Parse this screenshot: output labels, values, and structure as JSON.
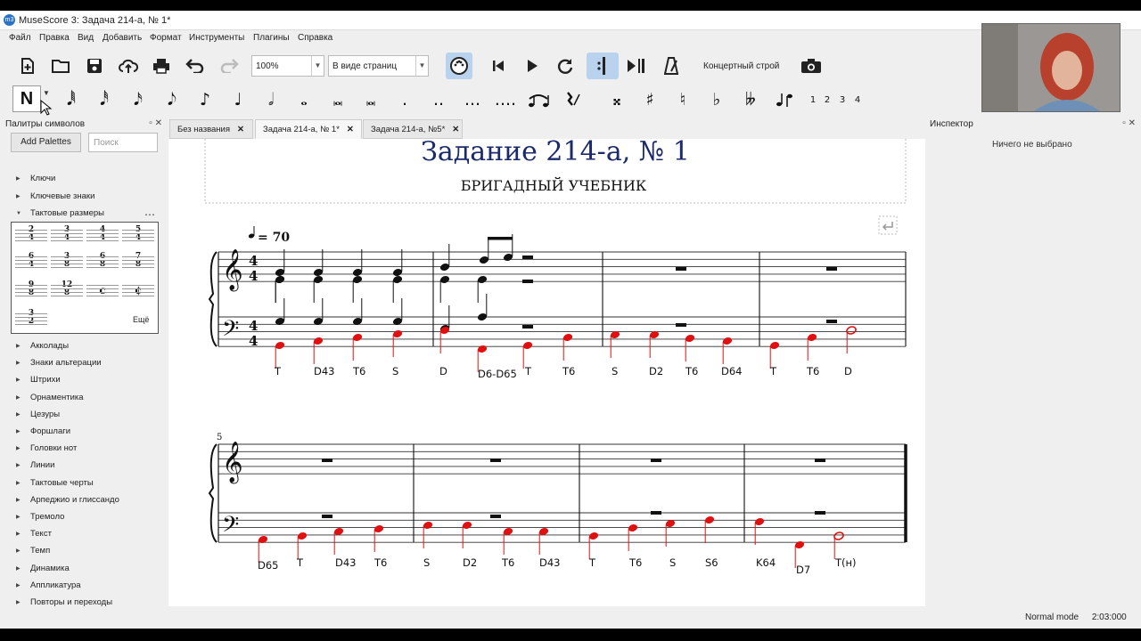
{
  "window": {
    "title": "MuseScore 3: Задача 214-а, № 1*"
  },
  "menu": [
    "Файл",
    "Правка",
    "Вид",
    "Добавить",
    "Формат",
    "Инструменты",
    "Плагины",
    "Справка"
  ],
  "toolbar": {
    "zoom_value": "100%",
    "view_mode": "В виде страниц",
    "concert_pitch": "Концертный строй"
  },
  "note_input": {
    "mode_label": "N",
    "durations": [
      "𝅘𝅥𝅱",
      "𝅘𝅥𝅰",
      "𝅘𝅥𝅯",
      "𝅘𝅥𝅮",
      "♪",
      "♩",
      "𝅗𝅥",
      "𝅝",
      "𝅜",
      "𝅜"
    ],
    "voices": [
      "1",
      "2",
      "3",
      "4"
    ]
  },
  "palette": {
    "title": "Палитры символов",
    "add_button": "Add Palettes",
    "search_placeholder": "Поиск",
    "expanded_section": "Тактовые размеры",
    "more_label": "Ещё",
    "time_signatures": [
      [
        "2",
        "4"
      ],
      [
        "3",
        "4"
      ],
      [
        "4",
        "4"
      ],
      [
        "5",
        "4"
      ],
      [
        "6",
        "4"
      ],
      [
        "3",
        "8"
      ],
      [
        "6",
        "8"
      ],
      [
        "7",
        "8"
      ],
      [
        "9",
        "8"
      ],
      [
        "12",
        "8"
      ],
      [
        "c",
        ""
      ],
      [
        "¢",
        ""
      ],
      [
        "3",
        "2"
      ]
    ],
    "sections_before": [
      "Ключи",
      "Ключевые знаки"
    ],
    "sections_after": [
      "Акколады",
      "Знаки альтерации",
      "Штрихи",
      "Орнаментика",
      "Цезуры",
      "Форшлаги",
      "Головки нот",
      "Линии",
      "Тактовые черты",
      "Арпеджио и глиссандо",
      "Тремоло",
      "Текст",
      "Темп",
      "Динамика",
      "Аппликатура",
      "Повторы и переходы"
    ]
  },
  "tabs": [
    {
      "label": "Без названия"
    },
    {
      "label": "Задача 214-а, № 1*"
    },
    {
      "label": "Задача 214-а, №5*"
    }
  ],
  "score": {
    "title": "Задание 214-а, № 1",
    "subtitle": "БРИГАДНЫЙ УЧЕБНИК",
    "tempo": "= 70",
    "measure_number": "5",
    "functions_line1": [
      "T",
      "D43",
      "T6",
      "S",
      "D",
      "D6-D65",
      "T",
      "T6",
      "S",
      "D2",
      "T6",
      "D64",
      "T",
      "T6",
      "D"
    ],
    "functions_line2": [
      "D65",
      "T",
      "D43",
      "T6",
      "S",
      "D2",
      "T6",
      "D43",
      "T",
      "T6",
      "S",
      "S6",
      "K64",
      "D7",
      "T(н)"
    ],
    "highlight_color": "#e01010"
  },
  "inspector": {
    "title": "Инспектор",
    "empty_text": "Ничего не выбрано"
  },
  "status": {
    "mode": "Normal mode",
    "position": "2:03:000"
  }
}
